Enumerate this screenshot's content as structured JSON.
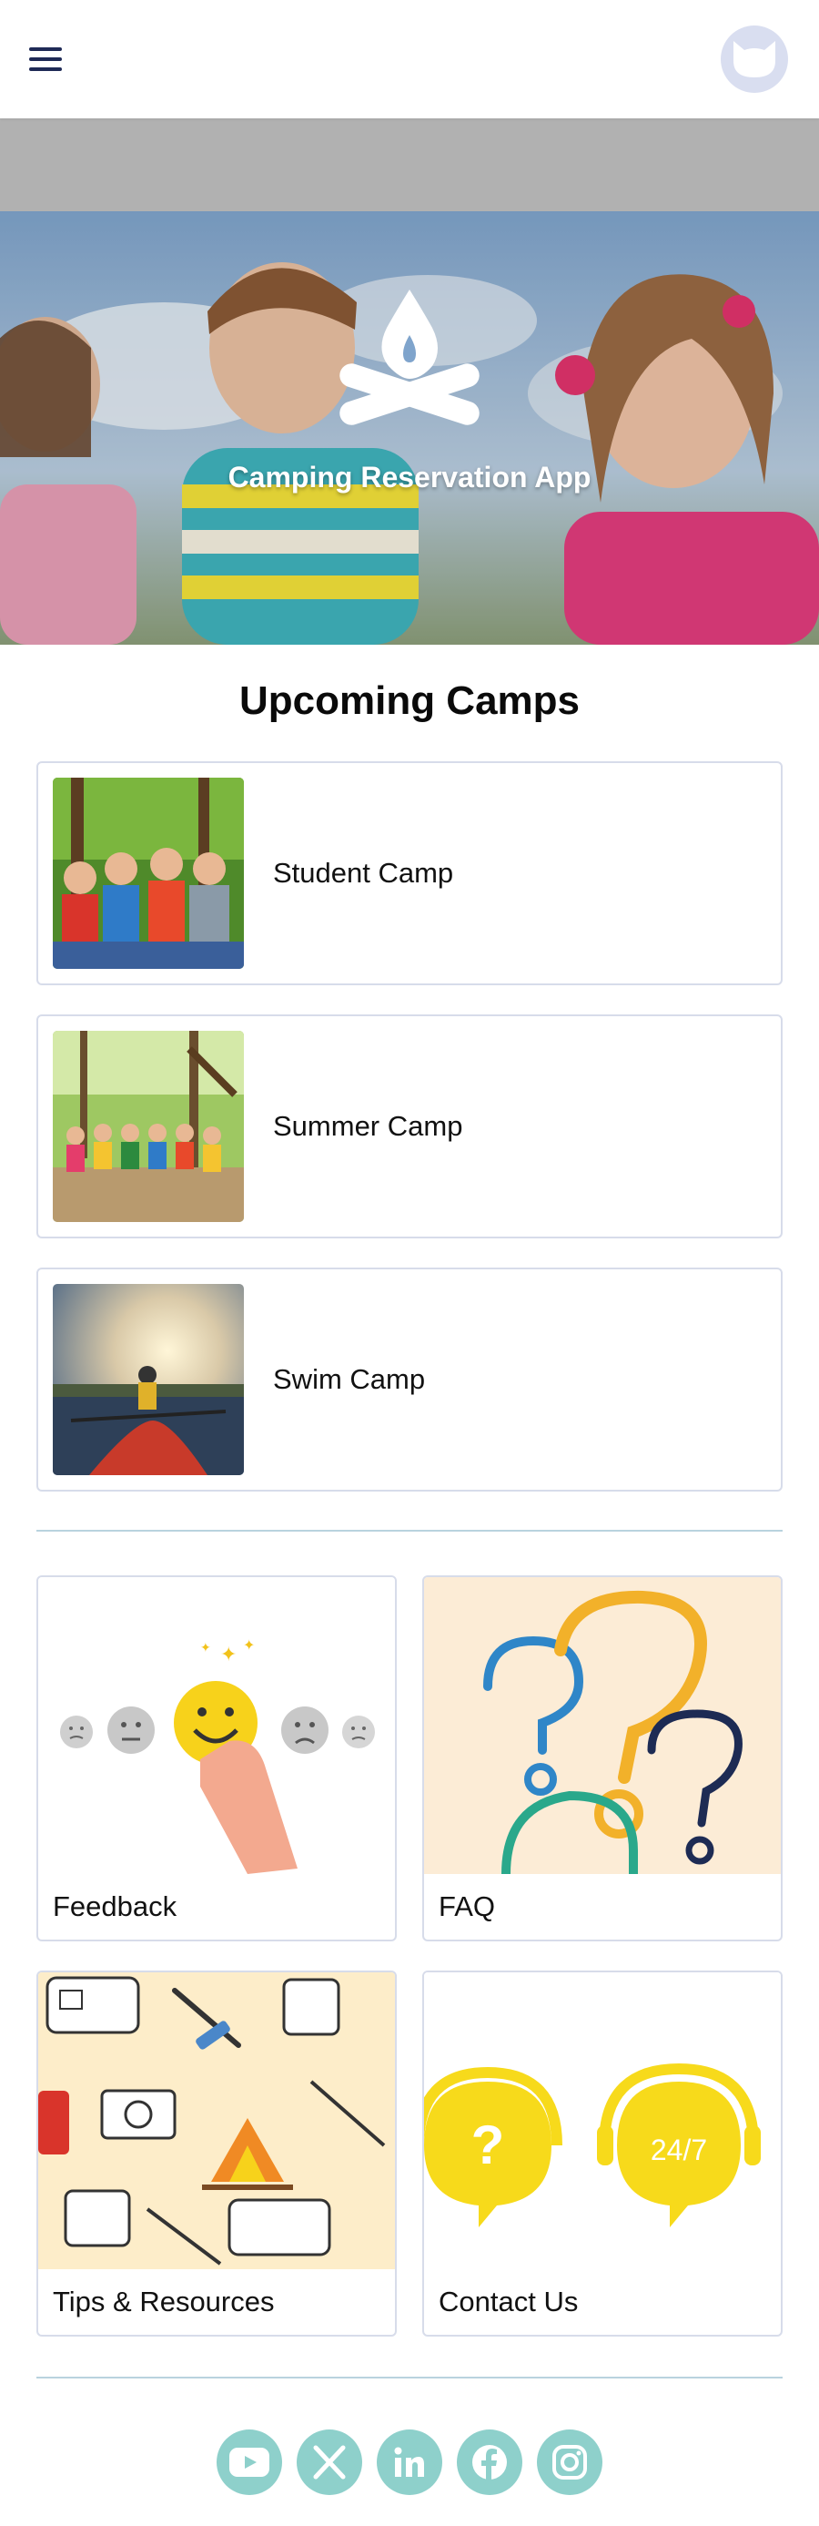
{
  "header": {
    "menu_icon": "hamburger-menu-icon",
    "avatar_icon": "cat-avatar-icon"
  },
  "hero": {
    "title": "Camping Reservation App",
    "logo_icon": "campfire-icon"
  },
  "upcoming": {
    "title": "Upcoming Camps",
    "camps": [
      {
        "label": "Student Camp",
        "image": "kids-in-forest-photo"
      },
      {
        "label": "Summer Camp",
        "image": "group-in-woods-photo"
      },
      {
        "label": "Swim Camp",
        "image": "kayak-sunset-photo"
      }
    ]
  },
  "tiles": [
    {
      "label": "Feedback",
      "image": "smiley-rating-illustration"
    },
    {
      "label": "FAQ",
      "image": "question-marks-illustration"
    },
    {
      "label": "Tips & Resources",
      "image": "camping-pattern-illustration"
    },
    {
      "label": "Contact Us",
      "image": "support-headset-illustration"
    }
  ],
  "contact_tile": {
    "badge": "24/7"
  },
  "social": [
    "youtube-icon",
    "x-icon",
    "linkedin-icon",
    "facebook-icon",
    "instagram-icon"
  ],
  "colors": {
    "accent_navy": "#1f2a56",
    "social_teal": "#8ed0cb",
    "card_border": "#d7dcea",
    "contact_yellow": "#f7da1b",
    "faq_bg": "#fcecd6"
  }
}
